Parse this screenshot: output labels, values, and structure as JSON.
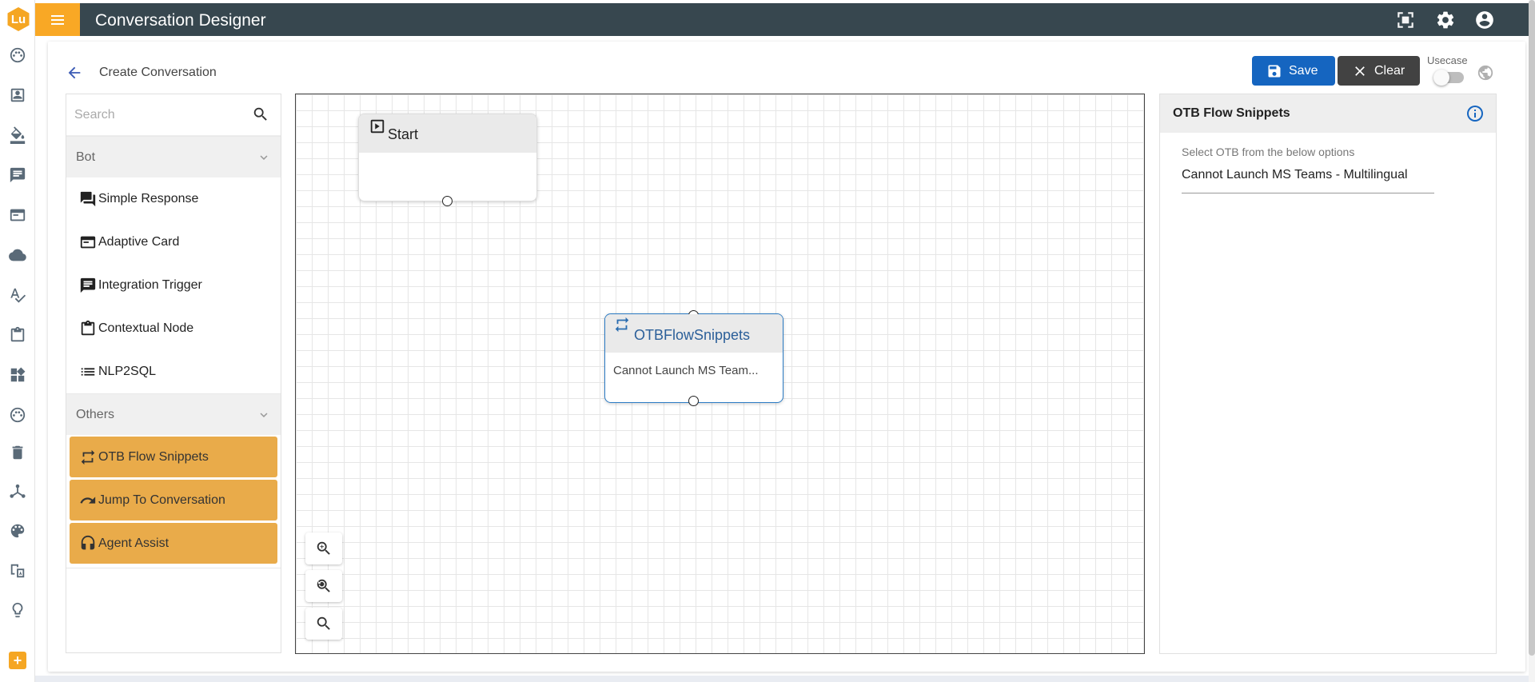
{
  "app": {
    "logo_text": "Lu",
    "title": "Conversation Designer",
    "add_label": "+"
  },
  "rail_icons": [
    "dashboard-icon",
    "contacts-icon",
    "format-paint-icon",
    "chat-icon",
    "card-icon",
    "cloud-icon",
    "spellcheck-icon",
    "clipboard-icon",
    "widgets-icon",
    "dashboard-alt-icon",
    "delete-icon",
    "hub-icon",
    "palette-icon",
    "translate-icon",
    "lightbulb-icon"
  ],
  "header_icons": [
    "fullscreen-icon",
    "settings-icon",
    "account-icon"
  ],
  "page": {
    "title": "Create Conversation",
    "save_label": "Save",
    "clear_label": "Clear",
    "usecase_label": "Usecase",
    "usecase_enabled": false
  },
  "palette": {
    "search_placeholder": "Search",
    "bot_section": "Bot",
    "bot_items": [
      {
        "label": "Simple Response",
        "icon": "forum-icon"
      },
      {
        "label": "Adaptive Card",
        "icon": "card-icon"
      },
      {
        "label": "Integration Trigger",
        "icon": "message-icon"
      },
      {
        "label": "Contextual Node",
        "icon": "clipboard-icon"
      },
      {
        "label": "NLP2SQL",
        "icon": "list-icon"
      }
    ],
    "others_section": "Others",
    "other_items": [
      {
        "label": "OTB Flow Snippets",
        "icon": "repeat-icon"
      },
      {
        "label": "Jump To Conversation",
        "icon": "redo-icon"
      },
      {
        "label": "Agent Assist",
        "icon": "headset-icon"
      }
    ]
  },
  "canvas": {
    "start_node": {
      "title": "Start"
    },
    "otb_node": {
      "title": "OTBFlowSnippets",
      "body": "Cannot Launch MS Team..."
    },
    "zoom_controls": [
      "zoom-in-icon",
      "zoom-reset-icon",
      "zoom-out-icon"
    ]
  },
  "properties": {
    "title": "OTB Flow Snippets",
    "select_label": "Select OTB from the below options",
    "selected_value": "Cannot Launch MS Teams - Multilingual"
  },
  "colors": {
    "header_bg": "#37474f",
    "menu_accent": "#f9a825",
    "save_button": "#1565c0",
    "clear_button": "#424242",
    "others_item_bg": "#e9ab4a",
    "node_selected_border": "#2b7bc4"
  }
}
